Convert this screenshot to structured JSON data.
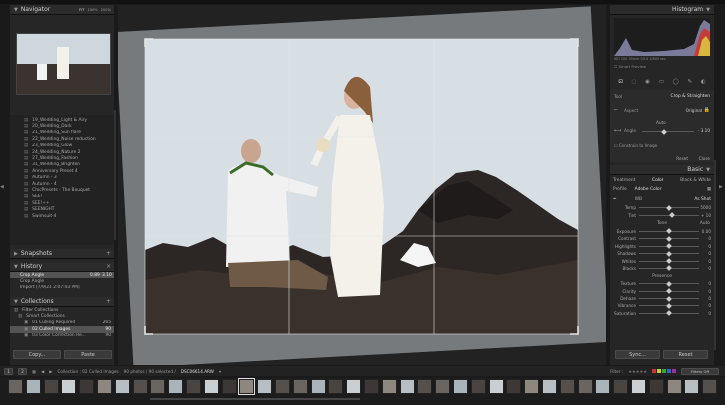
{
  "navigator": {
    "title": "Navigator",
    "zoom_fit": "FIT",
    "zoom_1": "100%",
    "zoom_2": "200%",
    "zoom_3": "1:1"
  },
  "presets": [
    "19_Wedding_Light & Airy",
    "20_Wedding_Dark",
    "21_Wedding_Sun flare",
    "22_Wedding_Noise reduction",
    "23_Wedding_Glow",
    "24_Wedding_Nature 2",
    "27_Wedding_Fashion",
    "31_Wedding_Brighten",
    "Anniversary Preset 4",
    "Autumn - 3",
    "Autumn - 4",
    "ChicPresets - The Bouquet",
    "SEE!",
    "SEE!++",
    "SEENIGHT",
    "Swimsuit-4"
  ],
  "snapshots": {
    "title": "Snapshots"
  },
  "history": {
    "title": "History",
    "items": [
      {
        "label": "Crop Angle",
        "v1": "0.89",
        "v2": "3.10"
      },
      {
        "label": "Crop Angle",
        "v1": "",
        "v2": ""
      },
      {
        "label": "Import (7/9/21 2:07:43 PM)",
        "v1": "",
        "v2": ""
      }
    ]
  },
  "collections": {
    "title": "Collections",
    "items": [
      "Filter Collections",
      "Smart Collections",
      "01 Culling Required",
      "02 Culled Images",
      "03 Color Correction Re..."
    ],
    "counts": [
      "",
      "",
      "265",
      "90",
      "90"
    ]
  },
  "left_buttons": {
    "copy": "Copy...",
    "paste": "Paste"
  },
  "histogram": {
    "title": "Histogram",
    "info": "ISO 100    35mm    f/4.0    1/800 sec",
    "smart_preview": "Smart Preview"
  },
  "crop": {
    "tool_label": "Tool",
    "tool_value": "Crop & Straighten",
    "aspect_label": "Aspect",
    "aspect_value": "Original",
    "auto": "Auto",
    "angle_label": "Angle",
    "angle_value": "- 3.10",
    "constrain": "Constrain to Image",
    "reset": "Reset",
    "close": "Close",
    "angle_pos": 0.42
  },
  "basic": {
    "title": "Basic",
    "treatment_label": "Treatment",
    "treat_color": "Color",
    "treat_bw": "Black & White",
    "profile_label": "Profile",
    "profile_value": "Adobe Color",
    "wb_label": "WB",
    "wb_value": "As Shot"
  },
  "sliders_wb": [
    {
      "label": "Temp",
      "value": "5000",
      "pos": 0.5
    },
    {
      "label": "Tint",
      "value": "+ 10",
      "pos": 0.55
    }
  ],
  "tone": {
    "title": "Tone",
    "auto": "Auto"
  },
  "sliders_tone": [
    {
      "label": "Exposure",
      "value": "0.00",
      "pos": 0.5
    },
    {
      "label": "Contrast",
      "value": "0",
      "pos": 0.5
    },
    {
      "label": "Highlights",
      "value": "0",
      "pos": 0.5
    },
    {
      "label": "Shadows",
      "value": "0",
      "pos": 0.5
    },
    {
      "label": "Whites",
      "value": "0",
      "pos": 0.5
    },
    {
      "label": "Blacks",
      "value": "0",
      "pos": 0.5
    }
  ],
  "presence": {
    "title": "Presence"
  },
  "sliders_presence": [
    {
      "label": "Texture",
      "value": "0",
      "pos": 0.5
    },
    {
      "label": "Clarity",
      "value": "0",
      "pos": 0.5
    },
    {
      "label": "Dehaze",
      "value": "0",
      "pos": 0.5
    },
    {
      "label": "Vibrance",
      "value": "0",
      "pos": 0.5
    },
    {
      "label": "Saturation",
      "value": "0",
      "pos": 0.5
    }
  ],
  "right_buttons": {
    "sync": "Sync...",
    "reset": "Reset"
  },
  "filmstrip": {
    "page1": "1",
    "page2": "2",
    "collection": "Collection : 02 Culled Images",
    "count": "90 photos / 90 selected /",
    "filename": "DSC06614.ARW",
    "filter_label": "Filter :",
    "filter_value": "Filters Off"
  },
  "colors": {
    "accent": "#6b8db5",
    "bg": "#1a1a1a",
    "panel": "#262626"
  }
}
